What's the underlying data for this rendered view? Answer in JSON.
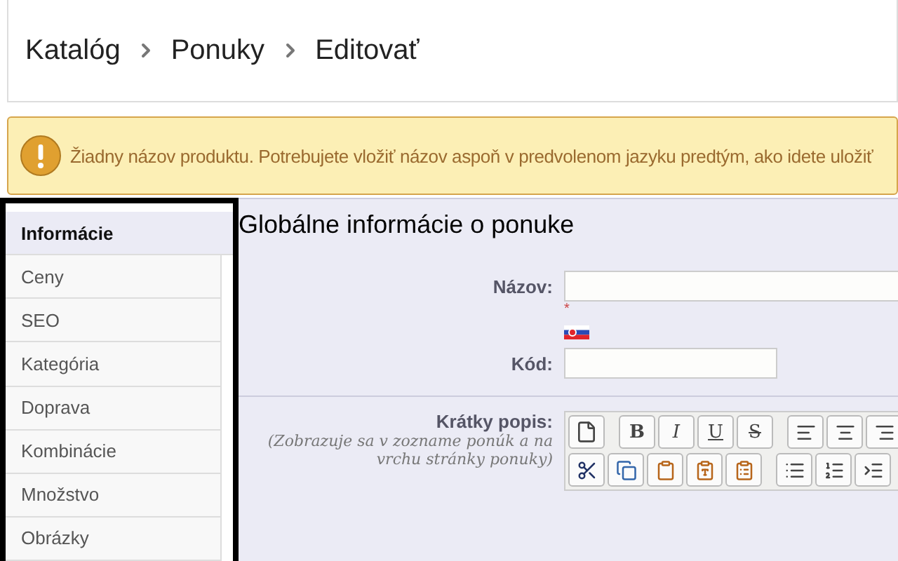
{
  "breadcrumb": [
    "Katalóg",
    "Ponuky",
    "Editovať"
  ],
  "warning": "Žiadny názov produktu. Potrebujete vložiť názov aspoň v predvolenom jazyku predtým, ako idete uložiť",
  "tabs": [
    {
      "label": "Informácie",
      "selected": true
    },
    {
      "label": "Ceny",
      "selected": false
    },
    {
      "label": "SEO",
      "selected": false
    },
    {
      "label": "Kategória",
      "selected": false
    },
    {
      "label": "Doprava",
      "selected": false
    },
    {
      "label": "Kombinácie",
      "selected": false
    },
    {
      "label": "Množstvo",
      "selected": false
    },
    {
      "label": "Obrázky",
      "selected": false
    }
  ],
  "heading": "Globálne informácie o ponuke",
  "name_field": {
    "label": "Názov:",
    "required_mark": "*"
  },
  "code_field": {
    "label": "Kód:"
  },
  "short_description": {
    "label": "Krátky popis:",
    "hint": "(Zobrazuje sa v zozname ponúk a na vrchu stránky ponuky)",
    "format_buttons": [
      "B",
      "I",
      "U",
      "S"
    ]
  }
}
